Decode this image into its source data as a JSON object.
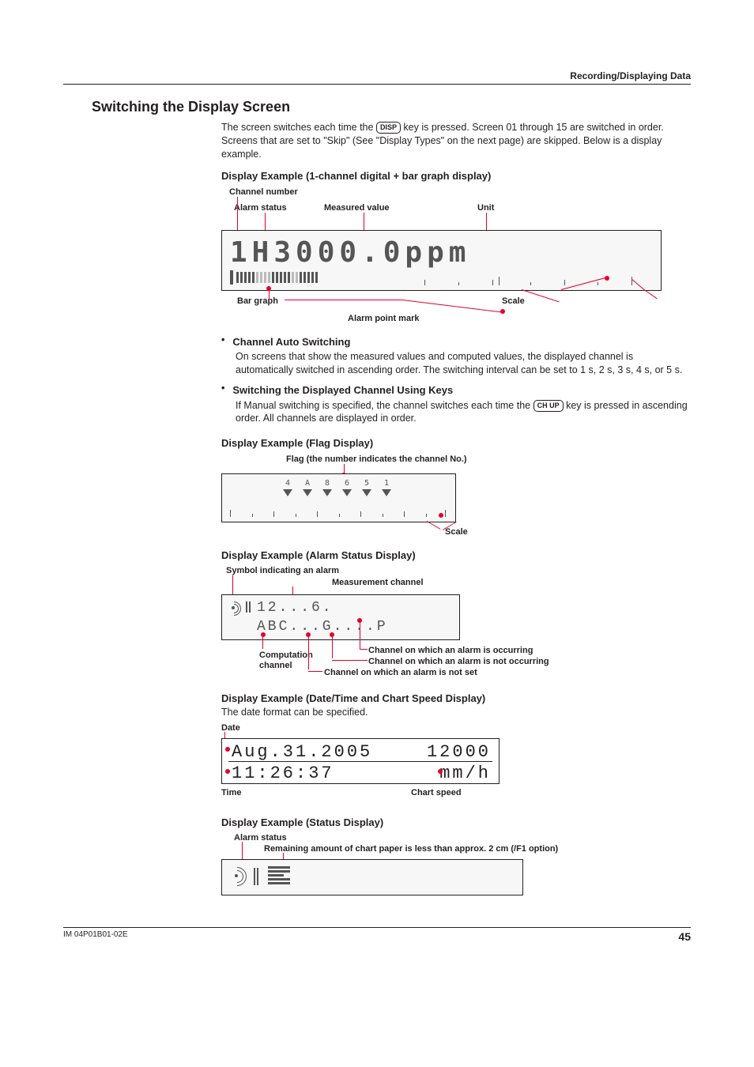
{
  "breadcrumb": "Recording/Displaying Data",
  "title": "Switching the Display Screen",
  "intro_pre": "The screen switches each time the ",
  "intro_key": "DISP",
  "intro_post": " key is pressed. Screen 01 through 15 are switched in order. Screens that are set to \"Skip\" (See \"Display Types\" on the next page) are skipped. Below is a display example.",
  "ex1": {
    "heading": "Display Example (1-channel digital + bar graph display)",
    "labels": {
      "channel_number": "Channel number",
      "alarm_status": "Alarm status",
      "measured_value": "Measured value",
      "unit": "Unit",
      "bar_graph": "Bar graph",
      "scale": "Scale",
      "alarm_point_mark": "Alarm point mark"
    },
    "lcd_text": "1H3000.0ppm"
  },
  "auto_switch": {
    "title": "Channel Auto Switching",
    "body": "On screens that show the measured values and computed values, the displayed channel is automatically switched in ascending order. The switching interval can be set to 1 s, 2 s, 3 s, 4 s, or 5 s."
  },
  "key_switch": {
    "title": "Switching the Displayed Channel Using Keys",
    "body_pre": "If Manual switching is specified, the channel switches each time the ",
    "key": "CH UP",
    "body_post": " key is pressed in ascending order. All channels are displayed in order."
  },
  "flag": {
    "heading": "Display Example (Flag Display)",
    "label_flag": "Flag (the number indicates the channel No.)",
    "label_scale": "Scale",
    "numbers": [
      "4",
      "A",
      "8",
      "6",
      "5",
      "1"
    ]
  },
  "alarm": {
    "heading": "Display Example (Alarm Status Display)",
    "label_symbol": "Symbol indicating an alarm",
    "label_meas": "Measurement channel",
    "label_comp_l1": "Computation",
    "label_comp_l2": "channel",
    "label_occ": "Channel on which an alarm is occurring",
    "label_notocc": "Channel on which an alarm is not occurring",
    "label_notset": "Channel on which an alarm is not set",
    "lcd_row1": "12...6.",
    "lcd_row2": "ABC...G....P"
  },
  "datetime": {
    "heading": "Display Example (Date/Time and Chart Speed Display)",
    "sub": "The date format can be specified.",
    "label_date": "Date",
    "label_time": "Time",
    "label_speed": "Chart speed",
    "row1_left": "Aug.31.2005",
    "row1_right": "12000",
    "row2_left": "11:26:37",
    "row2_right": "mm/h"
  },
  "status": {
    "heading": "Display Example (Status Display)",
    "label_alarm": "Alarm status",
    "label_paper": "Remaining amount of chart paper is less than approx. 2 cm (/F1 option)"
  },
  "footer_left": "IM 04P01B01-02E",
  "footer_right": "45"
}
